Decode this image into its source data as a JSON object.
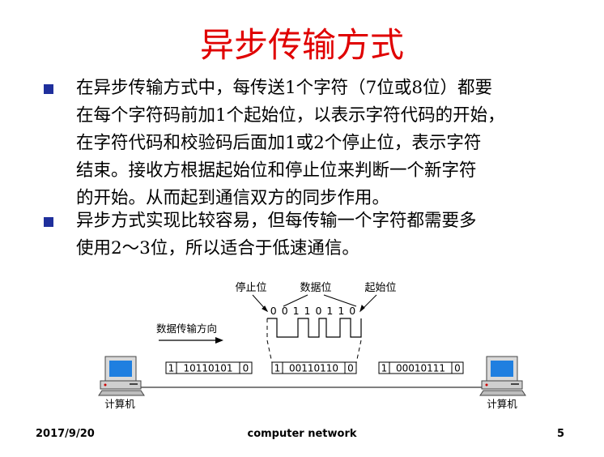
{
  "slide": {
    "title": "异步传输方式",
    "bullets": [
      {
        "lines": [
          "在异步传输方式中，每传送1个字符（7位或8位）都要",
          "在每个字符码前加1个起始位，以表示字符代码的开始，",
          "在字符代码和校验码后面加1或2个停止位，表示字符",
          "结束。接收方根据起始位和停止位来判断一个新字符",
          "的开始。从而起到通信双方的同步作用。"
        ]
      },
      {
        "lines": [
          "异步方式实现比较容易，但每传输一个字符都需要多",
          "使用2～3位，所以适合于低速通信。"
        ]
      }
    ]
  },
  "diagram": {
    "label_stop_bit": "停止位",
    "label_data_bits": "数据位",
    "label_start_bit": "起始位",
    "bit_sequence": "0 0 1 1 0 1 1 0",
    "direction_label": "数据传输方向",
    "frames": [
      {
        "start": "1",
        "data": "10110101",
        "stop": "0"
      },
      {
        "start": "1",
        "data": "00110110",
        "stop": "0"
      },
      {
        "start": "1",
        "data": "00010111",
        "stop": "0"
      }
    ],
    "computer_left_label": "计算机",
    "computer_right_label": "计算机"
  },
  "footer": {
    "date": "2017/9/20",
    "center": "computer network",
    "page": "5"
  },
  "colors": {
    "title": "#e00000",
    "bullet": "#1f2f9c"
  }
}
